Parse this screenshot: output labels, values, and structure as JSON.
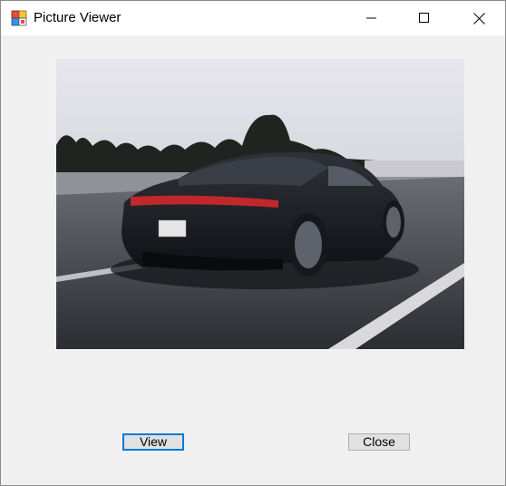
{
  "window": {
    "title": "Picture Viewer",
    "app_icon": "picture-viewer-app-icon",
    "controls": {
      "minimize_icon": "minimize-icon",
      "maximize_icon": "maximize-icon",
      "close_icon": "close-icon"
    }
  },
  "picture": {
    "image": "car-photo"
  },
  "buttons": {
    "view_label": "View",
    "close_label": "Close"
  },
  "colors": {
    "focus_border": "#0078d7",
    "window_bg": "#f0f0f0",
    "button_bg": "#e1e1e1"
  }
}
